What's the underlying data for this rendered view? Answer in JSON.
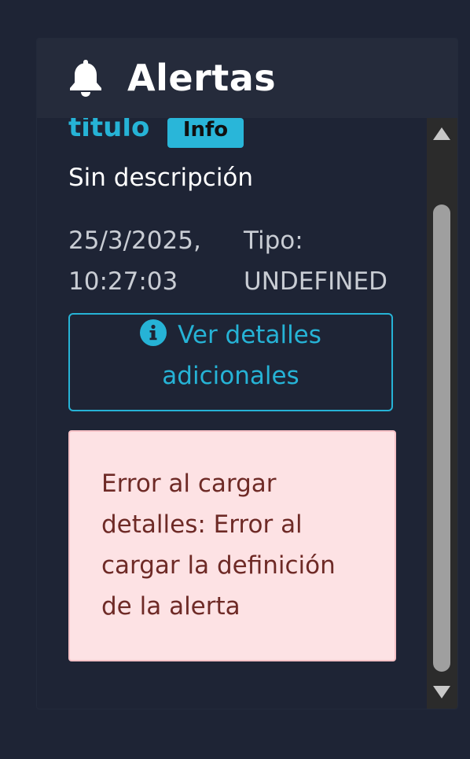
{
  "header": {
    "title": "Alertas",
    "icon": "bell-icon"
  },
  "alert": {
    "title": "titulo",
    "badge": "Info",
    "description": "Sin descripción",
    "date_line1": "25/3/2025,",
    "date_line2": "10:27:03",
    "type_line1": "Tipo:",
    "type_line2": "UNDEFINED",
    "details_button": {
      "icon": "info-icon",
      "line1": "Ver detalles",
      "line2": "adicionales"
    },
    "error_message": "Error al cargar detalles: Error al cargar la definición de la alerta"
  },
  "colors": {
    "accent": "#26b3d6",
    "background": "#1e2435",
    "header_bg": "#252b3b",
    "error_bg": "#fde2e4",
    "error_text": "#6e2a26"
  }
}
